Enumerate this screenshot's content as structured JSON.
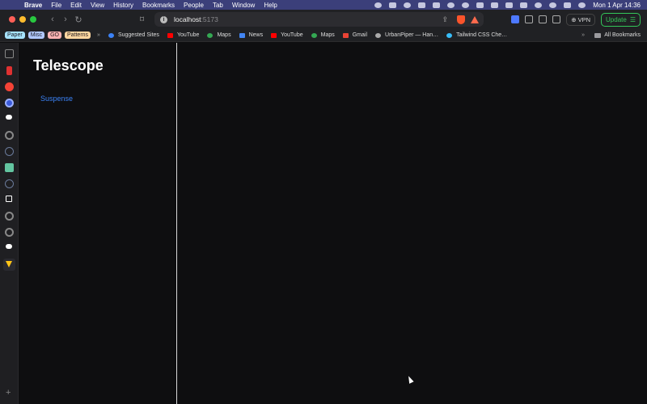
{
  "menubar": {
    "app_name": "Brave",
    "items": [
      "File",
      "Edit",
      "View",
      "History",
      "Bookmarks",
      "People",
      "Tab",
      "Window",
      "Help"
    ],
    "clock": "Mon 1 Apr  14:36"
  },
  "toolbar": {
    "url_host": "localhost",
    "url_port": ":5173",
    "vpn_label": "VPN",
    "update_label": "Update"
  },
  "bookmarks": {
    "chips": [
      {
        "label": "Paper",
        "color": "#a6e3ff"
      },
      {
        "label": "Misc",
        "color": "#b0c8ff"
      },
      {
        "label": "GO",
        "color": "#ffb3b3"
      },
      {
        "label": "Patterns",
        "color": "#ffd6a0"
      }
    ],
    "items": [
      {
        "label": "Suggested Sites",
        "color": "#3b82f6"
      },
      {
        "label": "YouTube",
        "color": "#ff0000"
      },
      {
        "label": "Maps",
        "color": "#34a853"
      },
      {
        "label": "News",
        "color": "#4285f4"
      },
      {
        "label": "YouTube",
        "color": "#ff0000"
      },
      {
        "label": "Maps",
        "color": "#34a853"
      },
      {
        "label": "Gmail",
        "color": "#ea4335"
      },
      {
        "label": "UrbanPiper — Han…",
        "color": "#aaaaaa"
      },
      {
        "label": "Tailwind CSS Che…",
        "color": "#38bdf8"
      }
    ],
    "all_label": "All Bookmarks"
  },
  "app": {
    "title": "Telescope",
    "nav_link": "Suspense"
  }
}
